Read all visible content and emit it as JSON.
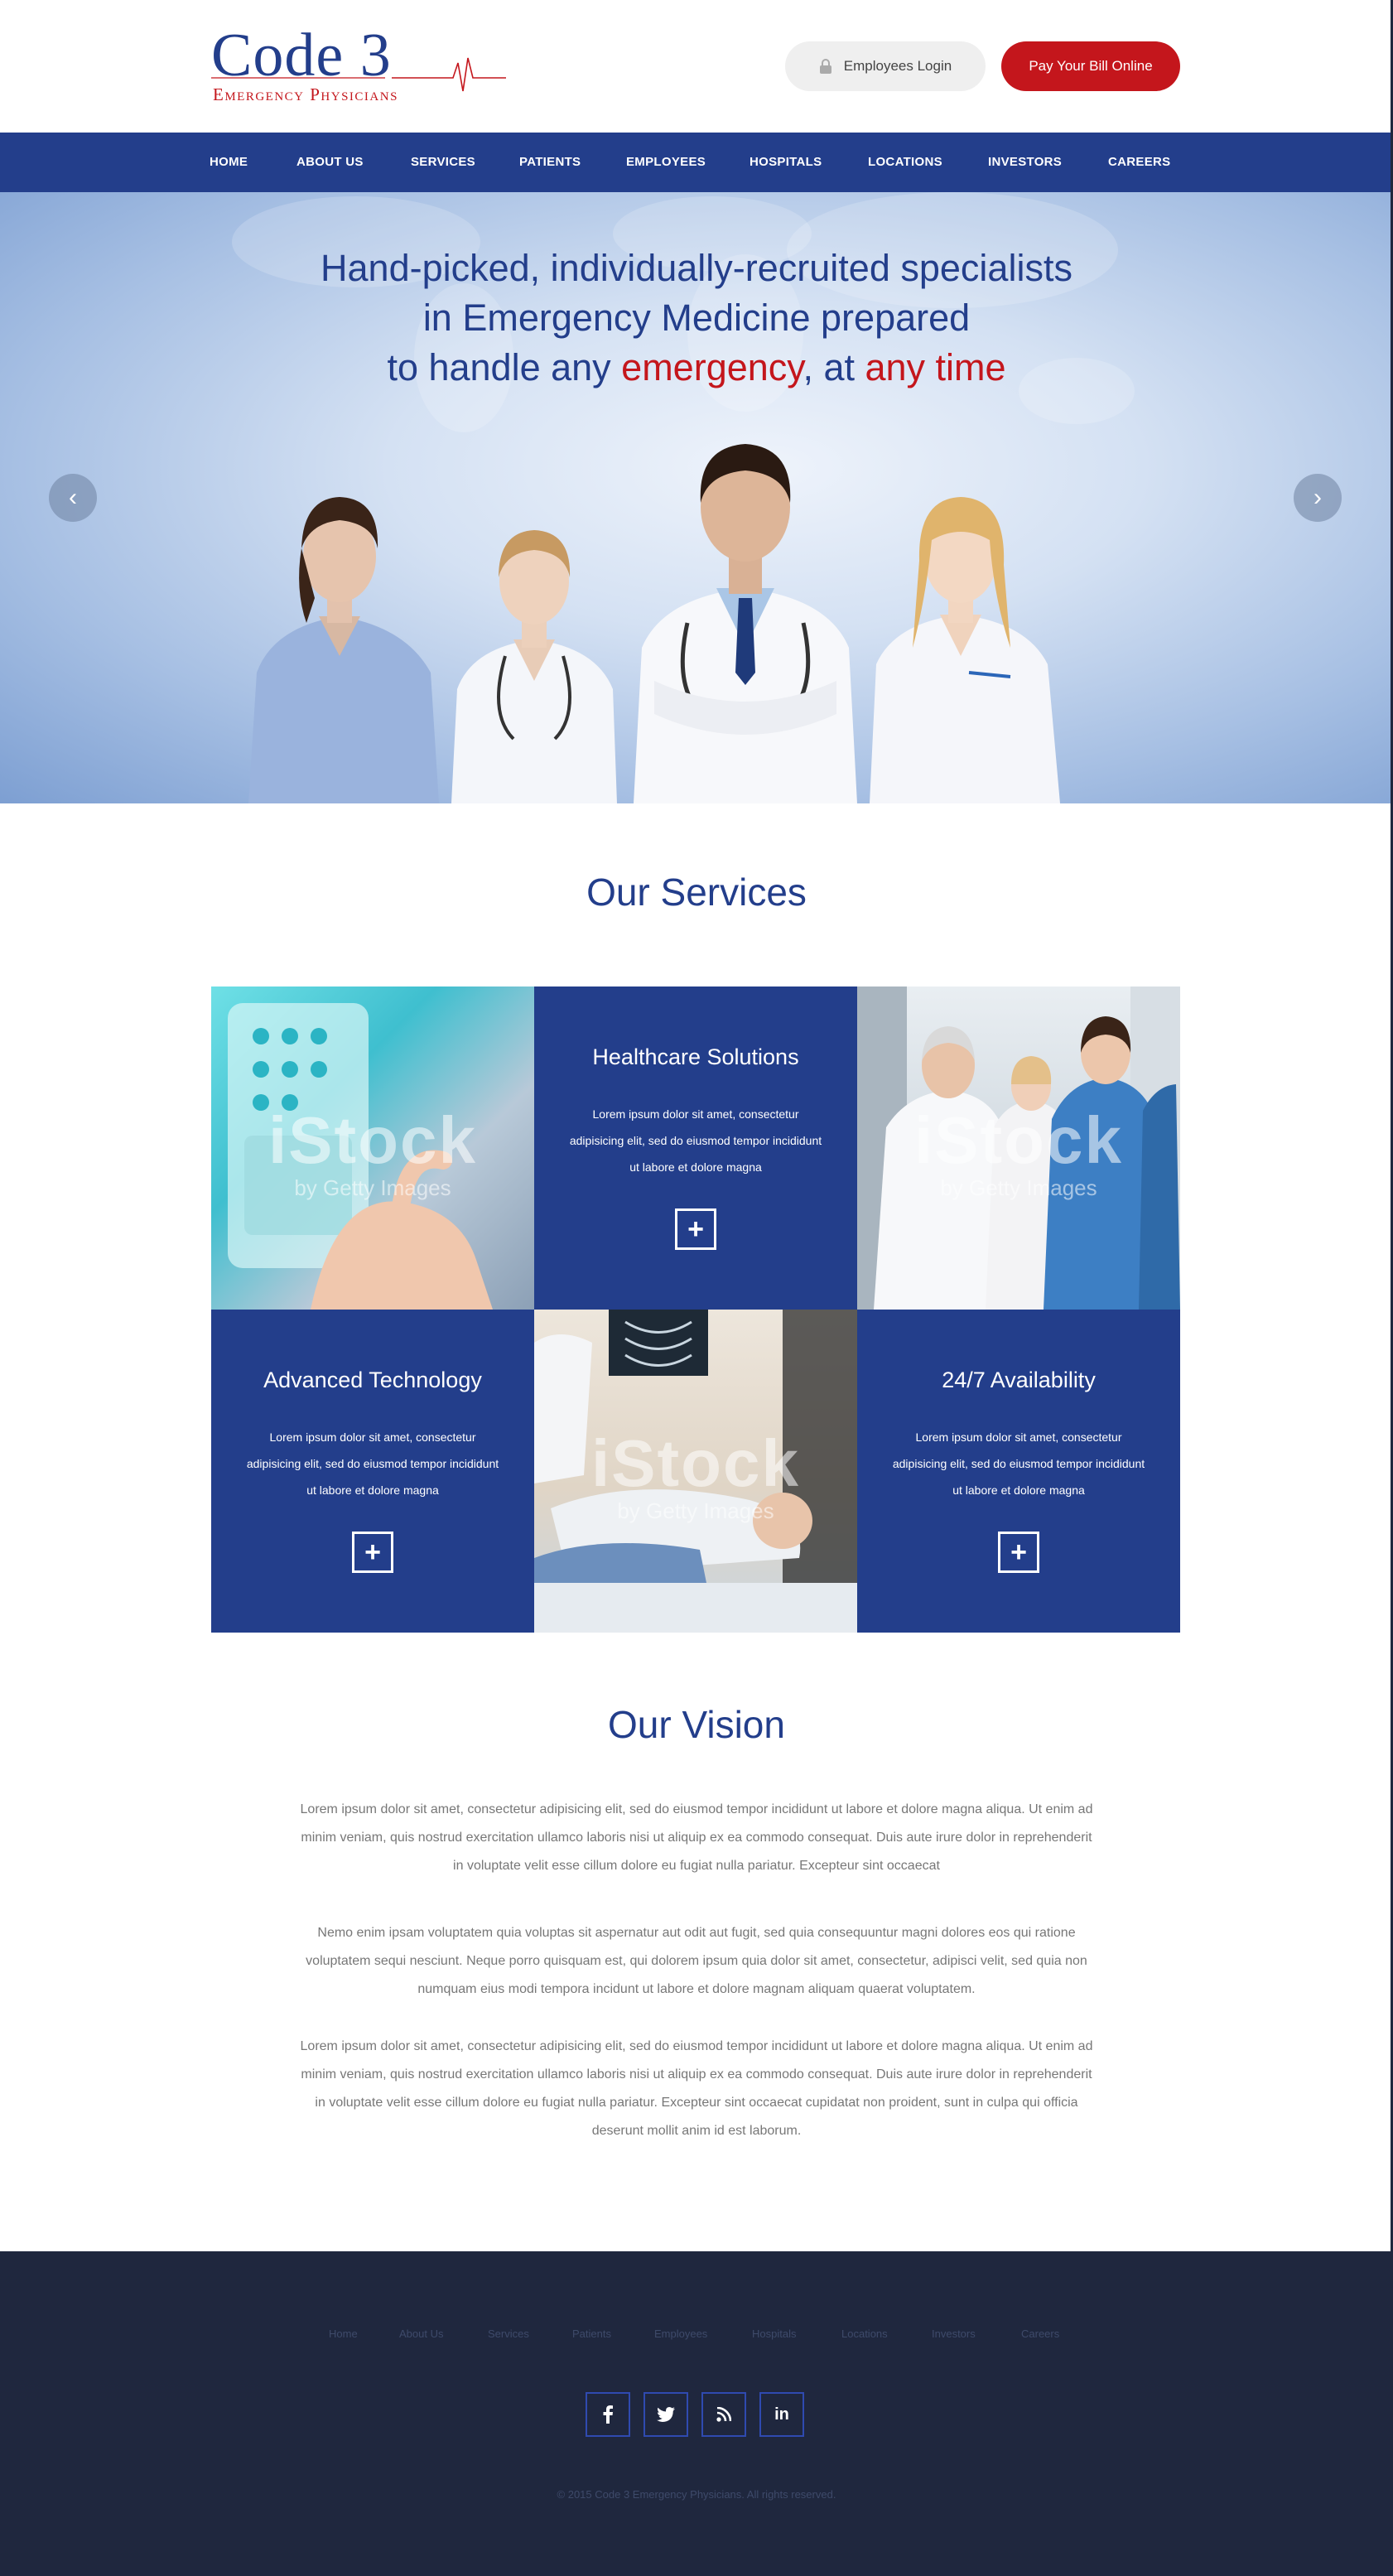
{
  "header": {
    "logo_main": "Code 3",
    "logo_sub": "Emergency Physicians",
    "login_label": "Employees Login",
    "pay_label": "Pay Your Bill Online"
  },
  "nav": {
    "items": [
      "HOME",
      "ABOUT US",
      "SERVICES",
      "PATIENTS",
      "EMPLOYEES",
      "HOSPITALS",
      "LOCATIONS",
      "INVESTORS",
      "CAREERS"
    ]
  },
  "hero": {
    "line1": "Hand-picked, individually-recruited specialists",
    "line2": "in Emergency Medicine prepared",
    "line3_a": "to handle any ",
    "line3_b": "emergency",
    "line3_c": ", at ",
    "line3_d": "any time",
    "prev_arrow": "‹",
    "next_arrow": "›"
  },
  "services": {
    "title": "Our Services",
    "cards": [
      {
        "title": "Healthcare Solutions",
        "desc": "Lorem ipsum dolor sit amet, consectetur adipisicing elit, sed do eiusmod tempor incididunt ut labore et dolore magna"
      },
      {
        "title": "Advanced Technology",
        "desc": "Lorem ipsum dolor sit amet, consectetur adipisicing elit, sed do eiusmod tempor incididunt ut labore et dolore magna"
      },
      {
        "title": "24/7 Availability",
        "desc": "Lorem ipsum dolor sit amet, consectetur adipisicing elit, sed do eiusmod tempor incididunt ut labore et dolore magna"
      }
    ],
    "plus": "+",
    "watermark": "iStock",
    "watermark_sub": "by Getty Images"
  },
  "vision": {
    "title": "Our Vision",
    "p1": "Lorem ipsum dolor sit amet, consectetur adipisicing elit, sed do eiusmod tempor incididunt ut labore et dolore magna aliqua. Ut enim ad minim veniam, quis nostrud exercitation ullamco laboris nisi ut aliquip ex ea commodo consequat. Duis aute irure dolor in reprehenderit in voluptate velit esse cillum dolore eu fugiat nulla pariatur. Excepteur sint occaecat",
    "p2": "Nemo enim ipsam voluptatem quia voluptas sit aspernatur aut odit aut fugit, sed quia consequuntur magni dolores eos qui ratione voluptatem sequi nesciunt. Neque porro quisquam est, qui dolorem ipsum quia dolor sit amet, consectetur, adipisci velit, sed quia non numquam eius modi tempora incidunt ut labore et dolore magnam aliquam quaerat voluptatem.",
    "p3": "Lorem ipsum dolor sit amet, consectetur adipisicing elit, sed do eiusmod tempor incididunt ut labore et dolore magna aliqua. Ut enim ad minim veniam, quis nostrud exercitation ullamco laboris nisi ut aliquip ex ea commodo consequat. Duis aute irure dolor in reprehenderit in voluptate velit esse cillum dolore eu fugiat nulla pariatur. Excepteur sint occaecat cupidatat non proident, sunt in culpa qui officia deserunt mollit anim id est laborum."
  },
  "footer": {
    "links": [
      "Home",
      "About Us",
      "Services",
      "Patients",
      "Employees",
      "Hospitals",
      "Locations",
      "Investors",
      "Careers"
    ],
    "social": {
      "facebook": "f",
      "twitter": "t",
      "rss": "rss",
      "linkedin": "in"
    },
    "copyright": "© 2015 Code 3 Emergency Physicians. All rights reserved."
  },
  "colors": {
    "brand_blue": "#233e8b",
    "brand_red": "#c4161c",
    "footer_bg": "#1f273e"
  }
}
